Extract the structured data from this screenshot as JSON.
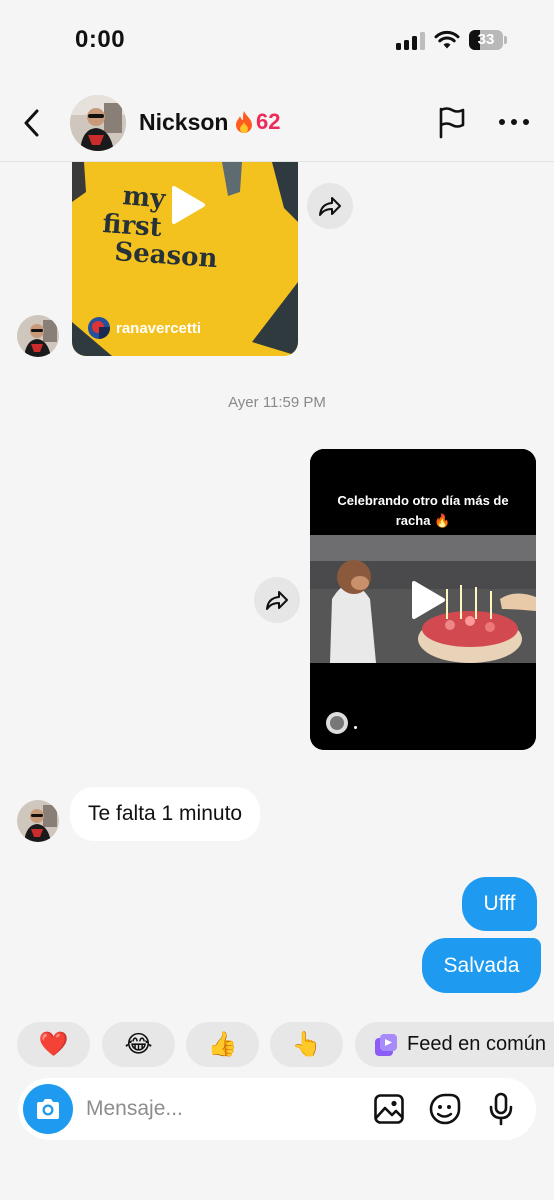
{
  "status_bar": {
    "time": "0:00",
    "battery": "33"
  },
  "header": {
    "name": "Nickson",
    "streak_count": "62"
  },
  "messages": {
    "video1_username": "ranavercetti",
    "timestamp": "Ayer 11:59 PM",
    "video2_caption": "Celebrando otro día más de racha 🔥",
    "incoming_text": "Te falta 1 minuto",
    "outgoing_1": "Ufff",
    "outgoing_2": "Salvada"
  },
  "reactions": {
    "heart": "❤️",
    "laugh": "😂",
    "thumbs": "👍",
    "point": "👆",
    "feed_label": "Feed en común"
  },
  "composer": {
    "placeholder": "Mensaje..."
  },
  "colors": {
    "accent": "#1e9bf0",
    "streak": "#ee2a5b",
    "background": "#f5f5f5"
  }
}
